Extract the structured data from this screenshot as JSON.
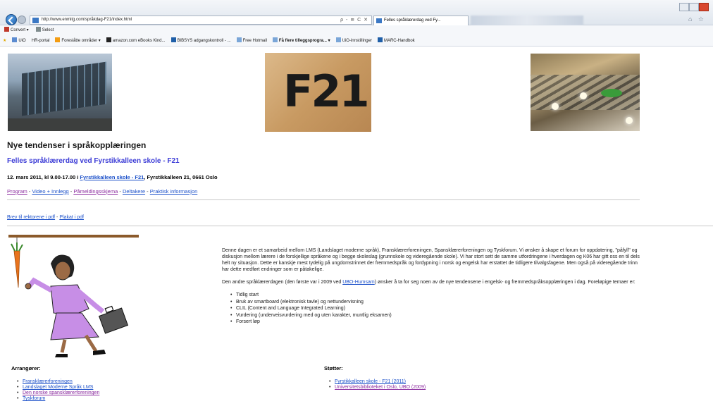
{
  "browser": {
    "url": "http://www.enmitg.com/språkdag-F21/index.html",
    "address_tools": "ρ - ≅ C ✕",
    "tab_title": "Felles språklærerdag ved Fy...",
    "command_bar": [
      "Convert",
      "Select"
    ],
    "favorites": [
      "UiO",
      "HR-portal",
      "Foreslåtte områder ▾",
      "amazon.com eBooks Kind...",
      "BIBSYS adgangskontroll - ...",
      "Free Hotmail",
      "Få flere tilleggsprogra... ▾",
      "UiO-innstillinger",
      "MARC-Handbok"
    ]
  },
  "page": {
    "sign_text": "F21",
    "main_heading": "Nye tendenser i språkopplæringen",
    "sub_heading": "Felles språklærerdag ved Fyrstikkalleen skole - F21",
    "date_prefix": "12. mars 2011, kl 9.00-17.00 i ",
    "date_link": "Fyrstikkalleen skole - F21",
    "date_suffix": ", Fyrstikkalleen 21, 0661 Oslo",
    "nav_links": [
      "Program",
      "Video + Innlegg",
      "Påmeldingsskjema",
      "Deltakere",
      "Praktisk informasjon"
    ],
    "nav_separator": " - ",
    "pdf_link_1": "Brev til rektorene i pdf",
    "pdf_separator": " - ",
    "pdf_link_2": "Plakat i pdf",
    "intro_p1": "Denne dagen er et samarbeid mellom LMS (Landslaget moderne språk), Fransklærerforeningen, Spansklærerforeningen og Tyskforum. Vi ønsker å skape et forum for oppdatering, \"påfyll\" og diskusjon mellom lærere i de forskjellige språkene og i begge skoleslag (grunnskole og videregående skole). Vi har stort sett de samme utfordringene i hverdagen og K06 har gitt oss en til dels helt ny situasjon. Dette er kanskje mest tydelig på ungdomstrinnet der fremmedspråk og fordypning i norsk og engelsk har erstattet de tidligere tilvalgsfagene. Men også på videregående trinn har dette medført endringer som er påtakelige.",
    "intro_p2_pre": "Den andre språklærerdagen (den første var i 2009 ved ",
    "intro_p2_link": "UBO-Humsam",
    "intro_p2_post": ") ønsker å ta for seg noen av de nye tendensene i engelsk- og fremmedspråksopplæringen i dag. Foreløpige temaer er:",
    "topics": [
      "Tidlig start",
      "Bruk av smartboard (elektronisk tavle) og nettundervisning",
      "CLIL (Content and Language Integrated Learning)",
      "Vurdering (underveisvurdering med og uten karakter, muntlig eksamen)",
      "Forsert løp"
    ],
    "organizers_heading": "Arrangører:",
    "organizers": [
      "Fransklærerforeningen",
      "Landslaget Moderne Språk LMS",
      "Den norske spansklærerforeningen",
      "Tyskforum"
    ],
    "supporters_heading": "Støtter:",
    "supporters": [
      "Fyrstikkalleen skole - F21 (2011)",
      "Universitetsbiblioteket i Oslo, UBO (2009)"
    ]
  },
  "colors": {
    "link": "#1a4fc9",
    "visited": "#8a2a9e",
    "sub_heading": "#3b3bd6"
  }
}
